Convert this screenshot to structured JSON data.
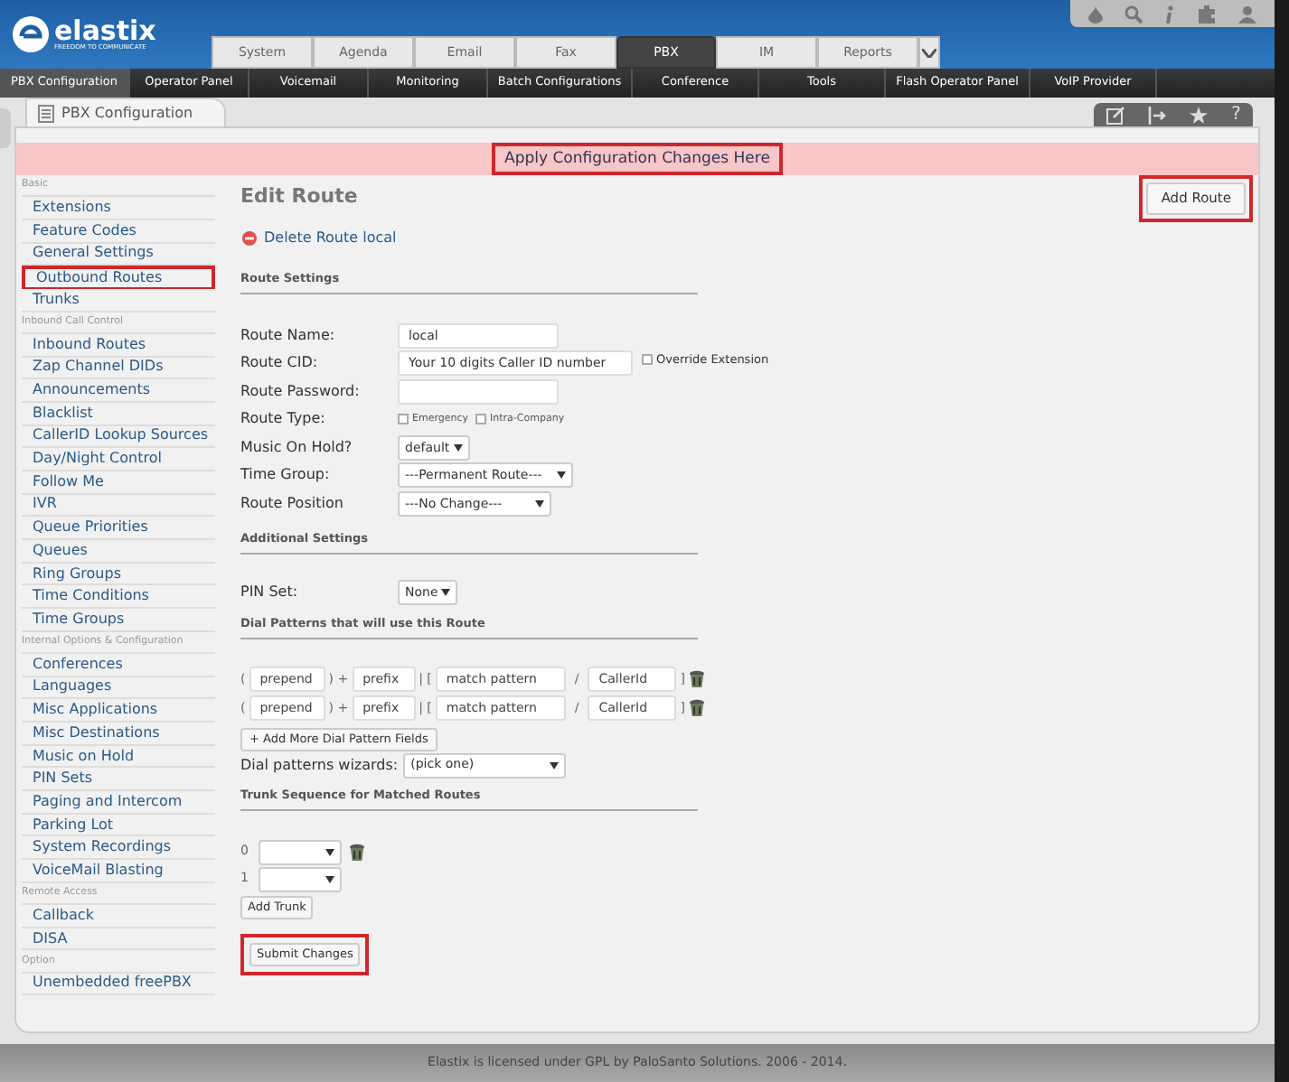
{
  "header": {
    "logo": "elastix",
    "tagline": "FREEDOM TO COMMUNICATE",
    "top_tabs": [
      {
        "label": "System",
        "selected": false
      },
      {
        "label": "Agenda",
        "selected": false
      },
      {
        "label": "Email",
        "selected": false
      },
      {
        "label": "Fax",
        "selected": false
      },
      {
        "label": "PBX",
        "selected": true
      },
      {
        "label": "IM",
        "selected": false
      },
      {
        "label": "Reports",
        "selected": false
      }
    ],
    "nav_items": [
      {
        "label": "PBX Configuration",
        "selected": true
      },
      {
        "label": "Operator Panel",
        "selected": false
      },
      {
        "label": "Voicemail",
        "selected": false
      },
      {
        "label": "Monitoring",
        "selected": false
      },
      {
        "label": "Batch Configurations",
        "selected": false
      },
      {
        "label": "Conference",
        "selected": false
      },
      {
        "label": "Tools",
        "selected": false
      },
      {
        "label": "Flash Operator Panel",
        "selected": false
      },
      {
        "label": "VoIP Provider",
        "selected": false
      }
    ]
  },
  "module_tab": {
    "title": "PBX Configuration",
    "help": "?"
  },
  "apply_bar": {
    "text": "Apply Configuration Changes Here",
    "highlighted": true
  },
  "sidebar": [
    {
      "title": "Basic",
      "items": [
        {
          "label": "Extensions",
          "selected": false
        },
        {
          "label": "Feature Codes",
          "selected": false
        },
        {
          "label": "General Settings",
          "selected": false
        },
        {
          "label": "Outbound Routes",
          "selected": true
        },
        {
          "label": "Trunks",
          "selected": false
        }
      ]
    },
    {
      "title": "Inbound Call Control",
      "items": [
        {
          "label": "Inbound Routes",
          "selected": false
        },
        {
          "label": "Zap Channel DIDs",
          "selected": false
        },
        {
          "label": "Announcements",
          "selected": false
        },
        {
          "label": "Blacklist",
          "selected": false
        },
        {
          "label": "CallerID Lookup Sources",
          "selected": false
        },
        {
          "label": "Day/Night Control",
          "selected": false
        },
        {
          "label": "Follow Me",
          "selected": false
        },
        {
          "label": "IVR",
          "selected": false
        },
        {
          "label": "Queue Priorities",
          "selected": false
        },
        {
          "label": "Queues",
          "selected": false
        },
        {
          "label": "Ring Groups",
          "selected": false
        },
        {
          "label": "Time Conditions",
          "selected": false
        },
        {
          "label": "Time Groups",
          "selected": false
        }
      ]
    },
    {
      "title": "Internal Options & Configuration",
      "items": [
        {
          "label": "Conferences",
          "selected": false
        },
        {
          "label": "Languages",
          "selected": false
        },
        {
          "label": "Misc Applications",
          "selected": false
        },
        {
          "label": "Misc Destinations",
          "selected": false
        },
        {
          "label": "Music on Hold",
          "selected": false
        },
        {
          "label": "PIN Sets",
          "selected": false
        },
        {
          "label": "Paging and Intercom",
          "selected": false
        },
        {
          "label": "Parking Lot",
          "selected": false
        },
        {
          "label": "System Recordings",
          "selected": false
        },
        {
          "label": "VoiceMail Blasting",
          "selected": false
        }
      ]
    },
    {
      "title": "Remote Access",
      "items": [
        {
          "label": "Callback",
          "selected": false
        },
        {
          "label": "DISA",
          "selected": false
        }
      ]
    },
    {
      "title": "Option",
      "items": [
        {
          "label": "Unembedded freePBX",
          "selected": false
        }
      ]
    }
  ],
  "main": {
    "heading": "Edit Route",
    "add_route": {
      "label": "Add Route",
      "highlighted": true
    },
    "delete_link": "Delete Route local",
    "route_settings": {
      "title": "Route Settings",
      "fields": [
        {
          "label": "Route Name:",
          "kind": "text",
          "value": "local"
        },
        {
          "label": "Route CID:",
          "kind": "text",
          "value": "Your 10 digits Caller ID number",
          "checkbox": {
            "label": "Override Extension",
            "checked": false
          }
        },
        {
          "label": "Route Password:",
          "kind": "text"
        },
        {
          "label": "Route Type:",
          "kind": "checkboxes",
          "options": [
            {
              "label": "Emergency",
              "checked": false
            },
            {
              "label": "Intra-Company",
              "checked": false
            }
          ]
        },
        {
          "label": "Music On Hold?",
          "kind": "select",
          "value": "default"
        },
        {
          "label": "Time Group:",
          "kind": "select",
          "value": "---Permanent Route---"
        },
        {
          "label": "Route Position",
          "kind": "select",
          "value": "---No Change---"
        }
      ]
    },
    "additional_settings": {
      "title": "Additional Settings",
      "fields": [
        {
          "label": "PIN Set:",
          "kind": "select",
          "value": "None"
        }
      ]
    },
    "dial_patterns": {
      "title": "Dial Patterns that will use this Route",
      "rows": [
        {
          "open": "(",
          "prepend": {
            "placeholder": "prepend"
          },
          "plus": ") +",
          "prefix": {
            "placeholder": "prefix"
          },
          "bar": "| [",
          "match": {
            "placeholder": "match pattern"
          },
          "slash": "/",
          "callerid": {
            "placeholder": "CallerId"
          },
          "close": "]"
        },
        {
          "open": "(",
          "prepend": {
            "placeholder": "prepend"
          },
          "plus": ") +",
          "prefix": {
            "placeholder": "prefix"
          },
          "bar": "| [",
          "match": {
            "placeholder": "match pattern"
          },
          "slash": "/",
          "callerid": {
            "placeholder": "CallerId"
          },
          "close": "]"
        }
      ],
      "add_more": "+ Add More Dial Pattern Fields",
      "wizard": {
        "label": "Dial patterns wizards:",
        "value": "(pick one)"
      }
    },
    "trunk_sequence": {
      "title": "Trunk Sequence for Matched Routes",
      "rows": [
        {
          "index": "0",
          "removable": true
        },
        {
          "index": "1",
          "removable": false
        }
      ],
      "add_trunk": "Add Trunk"
    },
    "submit": {
      "label": "Submit Changes",
      "highlighted": true
    }
  },
  "footer": "Elastix is licensed under GPL by PaloSanto Solutions. 2006 - 2014."
}
